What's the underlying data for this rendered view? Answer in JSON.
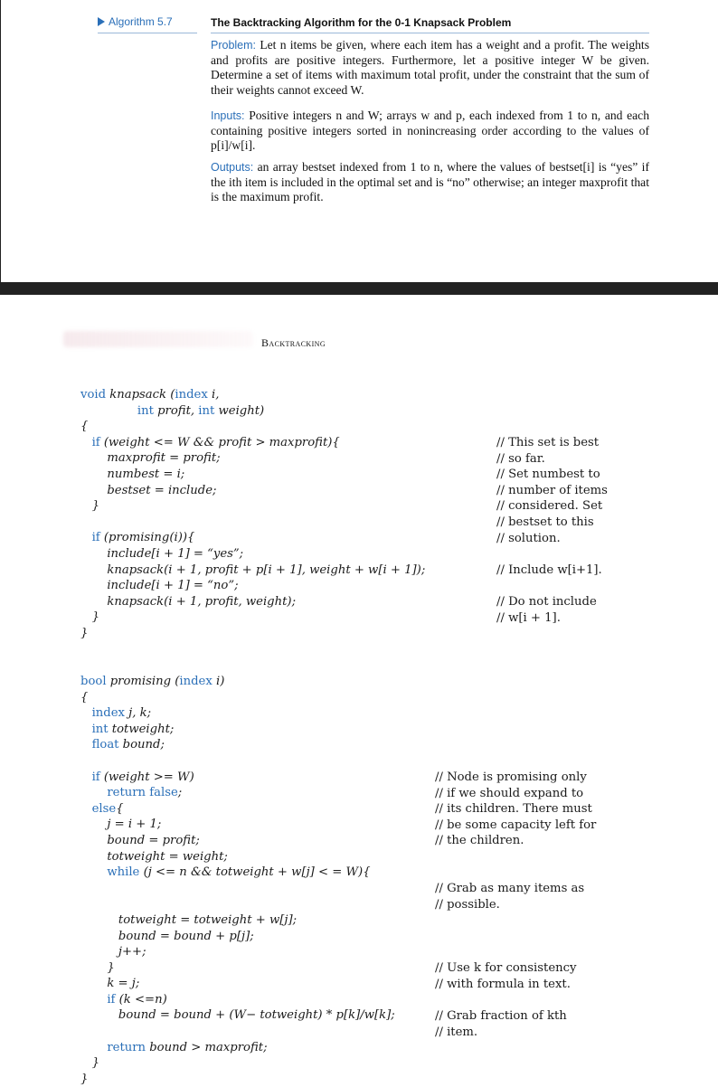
{
  "algorithm": {
    "tag": "Algorithm 5.7",
    "title": "The Backtracking Algorithm for the 0-1 Knapsack Problem",
    "problem_label": "Problem:",
    "problem_text": "Let n items be given, where each item has a weight and a profit. The weights and profits are positive integers. Furthermore, let a positive integer W be given. Determine a set of items with maximum total profit, under the constraint that the sum of their weights cannot exceed W.",
    "inputs_label": "Inputs:",
    "inputs_text": "Positive integers n and W; arrays w and p, each indexed from 1 to n, and each containing positive integers sorted in nonincreasing order according to the values of p[i]/w[i].",
    "outputs_label": "Outputs:",
    "outputs_text": "an array bestset indexed from 1 to n, where the values of bestset[i] is “yes” if the ith item is included in the optimal set and is “no” otherwise; an integer maxprofit that is the maximum profit."
  },
  "section_heading": "Backtracking",
  "code": {
    "knapsack_lines": [
      "void knapsack (index i,",
      "               int profit, int weight)",
      "{",
      "   if (weight <= W && profit > maxprofit){",
      "       maxprofit = profit;",
      "       numbest = i;",
      "       bestset = include;",
      "   }",
      "",
      "   if (promising(i)){",
      "       include[i + 1] = “yes”;",
      "       knapsack(i + 1, profit + p[i + 1], weight + w[i + 1]);",
      "       include[i + 1] = “no”;",
      "       knapsack(i + 1, profit, weight);",
      "   }",
      "}"
    ],
    "knapsack_comments_1": [
      "// This set is best",
      "// so far.",
      "// Set numbest to",
      "// number of items",
      "// considered. Set",
      "// bestset to this",
      "// solution."
    ],
    "knapsack_comments_2": [
      "// Include w[i+1].",
      "",
      "// Do not include",
      "// w[i + 1]."
    ],
    "promising_lines": [
      "bool promising (index i)",
      "{",
      "   index j, k;",
      "   int totweight;",
      "   float bound;",
      "",
      "   if (weight >= W)",
      "       return false;",
      "   else{",
      "       j = i + 1;",
      "       bound = profit;",
      "       totweight = weight;",
      "       while (j <= n && totweight + w[j] < = W){",
      "",
      "",
      "          totweight = totweight + w[j];",
      "          bound = bound + p[j];",
      "          j++;",
      "       }",
      "       k = j;",
      "       if (k <=n)",
      "          bound = bound + (W− totweight) * p[k]/w[k];",
      "",
      "       return bound > maxprofit;",
      "   }",
      "}"
    ],
    "promising_comments_1": [
      "// Node is promising only",
      "// if we should expand to",
      "// its children. There must",
      "// be some capacity left for",
      "// the children."
    ],
    "promising_comments_2": [
      "// Grab as many items as",
      "// possible."
    ],
    "promising_comments_3": [
      "// Use k for consistency",
      "// with formula in text."
    ],
    "promising_comments_4": [
      "// Grab fraction of kth",
      "// item."
    ]
  }
}
